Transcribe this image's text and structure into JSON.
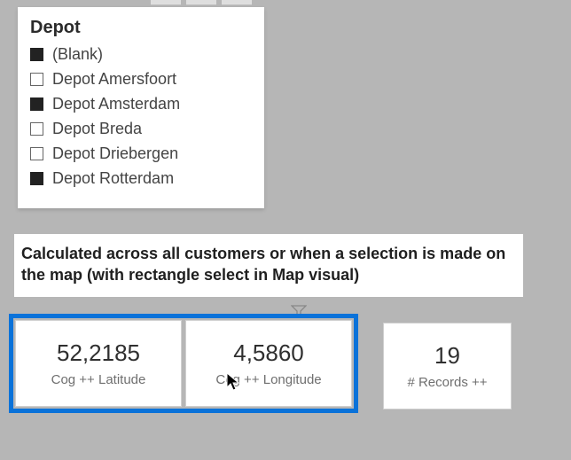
{
  "legend": {
    "title": "Depot",
    "items": [
      {
        "label": "(Blank)",
        "filled": true
      },
      {
        "label": "Depot Amersfoort",
        "filled": false
      },
      {
        "label": "Depot Amsterdam",
        "filled": true
      },
      {
        "label": "Depot Breda",
        "filled": false
      },
      {
        "label": "Depot Driebergen",
        "filled": false
      },
      {
        "label": "Depot Rotterdam",
        "filled": true
      }
    ]
  },
  "caption": "Calculated across all customers or when a selection is made on the map (with rectangle select in Map visual)",
  "cards": {
    "latitude": {
      "value": "52,2185",
      "label": "Cog ++ Latitude"
    },
    "longitude": {
      "value": "4,5860",
      "label": "Cog ++ Longitude"
    },
    "records": {
      "value": "19",
      "label": "# Records ++"
    }
  }
}
